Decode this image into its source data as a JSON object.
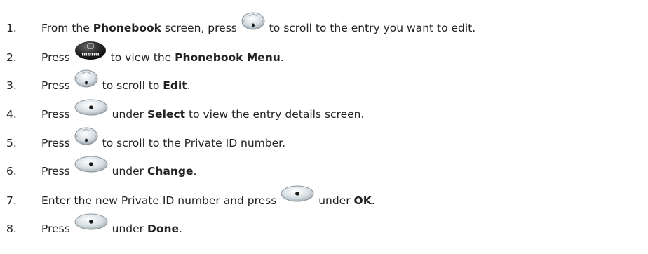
{
  "steps": [
    {
      "number": "1.",
      "parts": [
        {
          "t": "From the "
        },
        {
          "b": "Phonebook"
        },
        {
          "t": " screen, press "
        },
        {
          "icon": "nav-key"
        },
        {
          "t": " to scroll to the entry you want to edit."
        }
      ]
    },
    {
      "number": "2.",
      "parts": [
        {
          "t": "Press "
        },
        {
          "icon": "menu-key",
          "label": "menu"
        },
        {
          "t": " to view the "
        },
        {
          "b": "Phonebook Menu"
        },
        {
          "t": "."
        }
      ]
    },
    {
      "number": "3.",
      "parts": [
        {
          "t": "Press "
        },
        {
          "icon": "nav-key"
        },
        {
          "t": " to scroll to "
        },
        {
          "b": "Edit"
        },
        {
          "t": "."
        }
      ]
    },
    {
      "number": "4.",
      "parts": [
        {
          "t": "Press "
        },
        {
          "icon": "softkey"
        },
        {
          "t": " under "
        },
        {
          "b": "Select"
        },
        {
          "t": " to view the entry details screen."
        }
      ]
    },
    {
      "number": "5.",
      "parts": [
        {
          "t": "Press "
        },
        {
          "icon": "nav-key"
        },
        {
          "t": " to scroll to the Private ID number."
        }
      ]
    },
    {
      "number": "6.",
      "parts": [
        {
          "t": "Press "
        },
        {
          "icon": "softkey"
        },
        {
          "t": " under "
        },
        {
          "b": "Change"
        },
        {
          "t": "."
        }
      ]
    },
    {
      "number": "7.",
      "parts": [
        {
          "t": "Enter the new Private ID number and press "
        },
        {
          "icon": "softkey"
        },
        {
          "t": " under "
        },
        {
          "b": "OK"
        },
        {
          "t": "."
        }
      ]
    },
    {
      "number": "8.",
      "parts": [
        {
          "t": "Press "
        },
        {
          "icon": "softkey"
        },
        {
          "t": " under "
        },
        {
          "b": "Done"
        },
        {
          "t": "."
        }
      ]
    }
  ]
}
